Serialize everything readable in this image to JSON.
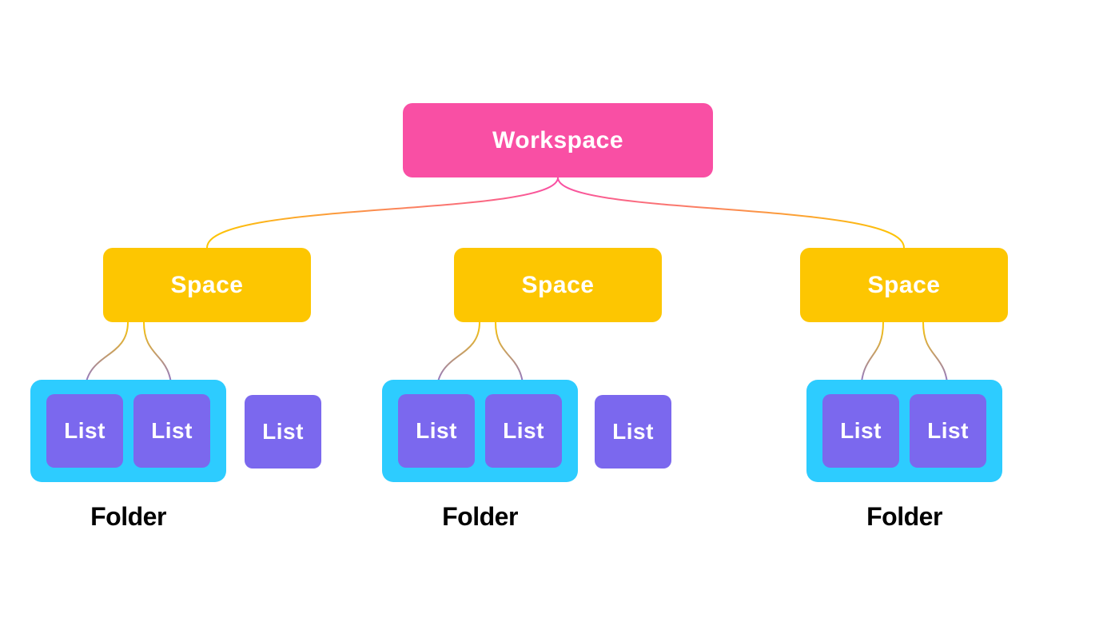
{
  "hierarchy": {
    "workspace": {
      "label": "Workspace",
      "color": "#f94fa4"
    },
    "spaces": [
      {
        "label": "Space",
        "color": "#fdc601"
      },
      {
        "label": "Space",
        "color": "#fdc601"
      },
      {
        "label": "Space",
        "color": "#fdc601"
      }
    ],
    "space_children": [
      {
        "folder": {
          "label": "Folder",
          "color": "#2dccff",
          "lists": [
            {
              "label": "List",
              "color": "#7b68ee"
            },
            {
              "label": "List",
              "color": "#7b68ee"
            }
          ]
        },
        "loose_lists": [
          {
            "label": "List",
            "color": "#7b68ee"
          }
        ]
      },
      {
        "folder": {
          "label": "Folder",
          "color": "#2dccff",
          "lists": [
            {
              "label": "List",
              "color": "#7b68ee"
            },
            {
              "label": "List",
              "color": "#7b68ee"
            }
          ]
        },
        "loose_lists": [
          {
            "label": "List",
            "color": "#7b68ee"
          }
        ]
      },
      {
        "folder": {
          "label": "Folder",
          "color": "#2dccff",
          "lists": [
            {
              "label": "List",
              "color": "#7b68ee"
            },
            {
              "label": "List",
              "color": "#7b68ee"
            }
          ]
        },
        "loose_lists": []
      }
    ]
  }
}
